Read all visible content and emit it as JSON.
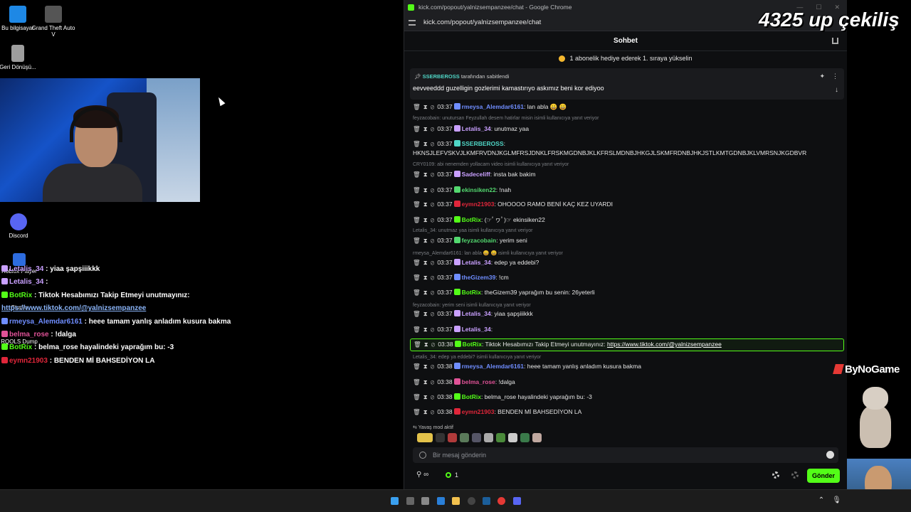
{
  "desktop": {
    "icons": [
      {
        "label": "Bu bilgisayar",
        "icon": "computer-icon",
        "color": "#1e88e5"
      },
      {
        "label": "Grand Theft Auto V",
        "icon": "gta-icon",
        "color": "#555555"
      },
      {
        "label": "Geri Dönüşü...",
        "icon": "recycle-bin-icon",
        "color": "#9e9e9e"
      },
      {
        "label": "Discord",
        "icon": "discord-icon",
        "color": "#5865f2"
      },
      {
        "label": "Roblox Player",
        "icon": "roblox-icon",
        "color": "#2d6cdf"
      },
      {
        "label": "Studio",
        "icon": "roblox-studio-icon",
        "color": "#2d6cdf"
      },
      {
        "label": "RQOLS Dump",
        "icon": "app-icon",
        "color": "#444444"
      }
    ]
  },
  "overlay_chat": [
    {
      "user": "Letalis_34",
      "text": "yiaa şapşiiikkk",
      "color": "#c9a0ff"
    },
    {
      "user": "Letalis_34",
      "text": "",
      "color": "#c9a0ff"
    },
    {
      "user": "BotRix",
      "text": "Tiktok Hesabımızı Takip Etmeyi unutmayınız:",
      "color": "#53fc18"
    },
    {
      "user": "",
      "text": "https://www.tiktok.com/@yalnizsempanzee",
      "color": "#8ab4f8"
    },
    {
      "user": "rmeysa_Alemdar6161",
      "text": "heee tamam yanlış anladım kusura bakma",
      "color": "#6f8dff"
    },
    {
      "user": "belma_rose",
      "text": "!dalga",
      "color": "#e05297"
    },
    {
      "user": "BotRix",
      "text": "belma_rose hayalindeki yaprağım bu: -3",
      "color": "#53fc18"
    },
    {
      "user": "eymn21903",
      "text": "BENDEN Mİ BAHSEDİYON LA",
      "color": "#e0263a"
    }
  ],
  "browser": {
    "title": "kick.com/popout/yalnizsempanzee/chat - Google Chrome",
    "url": "kick.com/popout/yalnizsempanzee/chat"
  },
  "chat": {
    "header": "Sohbet",
    "promo": "1 abonelik hediye ederek 1. sıraya yükselin",
    "pinned": {
      "by_user": "SSERBEROSS",
      "by_suffix": "tarafından sabitlendi",
      "message": "eevveeddd guzelligin gozlerimi kamastırıyo askımız beni kor ediyoo"
    },
    "slow_mode": "Yavaş mod aktif",
    "input_placeholder": "Bir mesaj gönderin",
    "viewer_count": "1",
    "send_label": "Gönder",
    "colors": {
      "accent": "#53fc18",
      "bg": "#0e0f11"
    },
    "messages": [
      {
        "time": "03:37",
        "user": "rmeysa_Alemdar6161",
        "text": ": lan abla 😀 😀",
        "color": "#6f8dff"
      },
      {
        "reply": "feyzacobain: unutursan Feyzullah desem hatirlar misin isimli kullanıcıya yanıt veriyor"
      },
      {
        "time": "03:37",
        "user": "Letalis_34",
        "text": ": unutmaz yaa",
        "color": "#c9a0ff"
      },
      {
        "time": "03:37",
        "user": "SSERBEROSS",
        "text": ":",
        "color": "#4fd6c6"
      },
      {
        "cont": "HKNSJLEFVSKVJLKMFRVDNJKGLMFRSJDNKLFRSKMGDNBJKLKFRSLMDNBJHKGJLSKMFRDNBJHKJSTLKMTGDNBJKLVMRSNJKGDBVR"
      },
      {
        "reply": "CRY0109: abi nenemden yollacam video isimli kullanıcıya yanıt veriyor"
      },
      {
        "time": "03:37",
        "user": "Sadeceliff",
        "text": ": insta bak bakim",
        "color": "#c9a0ff"
      },
      {
        "time": "03:37",
        "user": "ekinsiken22",
        "text": ": !nah",
        "color": "#53d96f"
      },
      {
        "time": "03:37",
        "user": "eymn21903",
        "text": ": OHOOOO RAMO BENİ KAÇ KEZ UYARDI",
        "color": "#e0263a"
      },
      {
        "time": "03:37",
        "user": "BotRix",
        "text": ": (☞ﾟヮﾟ)☞ ekinsiken22",
        "color": "#53fc18"
      },
      {
        "reply": "Letalis_34: unutmaz yaa isimli kullanıcıya yanıt veriyor"
      },
      {
        "time": "03:37",
        "user": "feyzacobain",
        "text": ": yerim seni",
        "color": "#53d96f"
      },
      {
        "reply": "rmeysa_Alemdar6161: lan abla 😀 😀 isimli kullanıcıya yanıt veriyor"
      },
      {
        "time": "03:37",
        "user": "Letalis_34",
        "text": ": edep ya eddebi?",
        "color": "#c9a0ff"
      },
      {
        "time": "03:37",
        "user": "theGizem39",
        "text": ": !cm",
        "color": "#6f8dff"
      },
      {
        "time": "03:37",
        "user": "BotRix",
        "text": ": theGizem39 yaprağım bu senin: 26yeterli",
        "color": "#53fc18"
      },
      {
        "reply": "feyzacobain: yerim seni isimli kullanıcıya yanıt veriyor"
      },
      {
        "time": "03:37",
        "user": "Letalis_34",
        "text": ": yiaa şapşiiikkk",
        "color": "#c9a0ff"
      },
      {
        "time": "03:37",
        "user": "Letalis_34",
        "text": ":",
        "color": "#c9a0ff"
      },
      {
        "time": "03:38",
        "user": "BotRix",
        "text": ": Tiktok Hesabımızı Takip Etmeyi unutmayınız: ",
        "link": "https://www.tiktok.com/@yalnizsempanzee",
        "color": "#53fc18",
        "highlight": true
      },
      {
        "reply": "Letalis_34: edep ya eddebi? isimli kullanıcıya yanıt veriyor"
      },
      {
        "time": "03:38",
        "user": "rmeysa_Alemdar6161",
        "text": ": heee tamam yanlış anladım kusura bakma",
        "color": "#6f8dff"
      },
      {
        "time": "03:38",
        "user": "belma_rose",
        "text": ": !dalga",
        "color": "#e05297"
      },
      {
        "time": "03:38",
        "user": "BotRix",
        "text": ": belma_rose hayalindeki yaprağım bu: -3",
        "color": "#53fc18"
      },
      {
        "time": "03:38",
        "user": "eymn21903",
        "text": ": BENDEN Mİ BAHSEDİYON LA",
        "color": "#e0263a"
      }
    ]
  },
  "stream_overlay": {
    "giveaway": "4325 up çekiliş",
    "sponsor": "ByNoGame"
  }
}
